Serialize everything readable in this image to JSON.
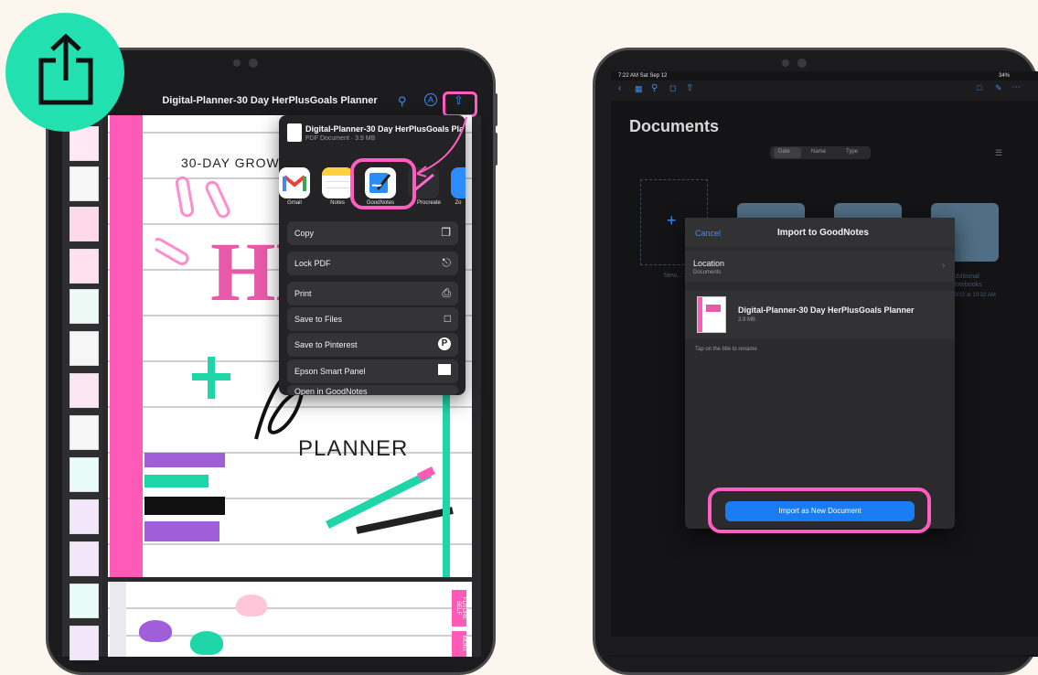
{
  "colors": {
    "background": "#fcf6ee",
    "badge": "#23e0b0",
    "highlight": "#ff5ec0",
    "accent": "#1a7cf5",
    "planner_pink": "#ff5ab8"
  },
  "share_badge": {
    "icon": "share-icon"
  },
  "left_tablet": {
    "title": "Digital-Planner-30 Day HerPlusGoals Planner",
    "toolbar_icons": [
      "search-icon",
      "pen-icon",
      "share-icon"
    ],
    "page": {
      "heading": "30-DAY GROWT",
      "big_text": "HE",
      "footer": "PLANNER",
      "side_tabs": [
        "FUTURE SELF",
        "MONT"
      ]
    },
    "share_sheet": {
      "file_name": "Digital-Planner-30 Day HerPlusGoals Pla...",
      "file_meta": "PDF Document · 3.9 MB",
      "apps": [
        {
          "label": "Gmail",
          "icon": "gmail-icon"
        },
        {
          "label": "Notes",
          "icon": "notes-icon"
        },
        {
          "label": "GoodNotes",
          "icon": "goodnotes-icon"
        },
        {
          "label": "Procreate",
          "icon": "procreate-icon"
        },
        {
          "label": "Zo",
          "icon": "zoom-icon"
        }
      ],
      "actions": [
        {
          "label": "Copy",
          "icon": "copy-icon"
        },
        {
          "label": "Lock PDF",
          "icon": "lock-icon"
        },
        {
          "label": "Print",
          "icon": "print-icon"
        },
        {
          "label": "Save to Files",
          "icon": "folder-icon"
        },
        {
          "label": "Save to Pinterest",
          "icon": "pinterest-icon"
        },
        {
          "label": "Epson Smart Panel",
          "icon": "epson-icon"
        },
        {
          "label": "Open in GoodNotes",
          "icon": "open-icon"
        }
      ]
    }
  },
  "right_tablet": {
    "status": "7:22 AM  Sat Sep 12",
    "battery": "34%",
    "documents_title": "Documents",
    "sort_tabs": [
      "Date",
      "Name",
      "Type"
    ],
    "new_label": "New...",
    "folder_caption": "Additional Notebooks",
    "folder_meta": "10/10 at 10:32 AM",
    "dialog": {
      "cancel": "Cancel",
      "title": "Import to GoodNotes",
      "location_label": "Location",
      "location_value": "Documents",
      "doc_title": "Digital-Planner-30 Day HerPlusGoals Planner",
      "doc_size": "3.9 MB",
      "hint": "Tap on the title to rename",
      "import_button": "Import as New Document"
    }
  }
}
